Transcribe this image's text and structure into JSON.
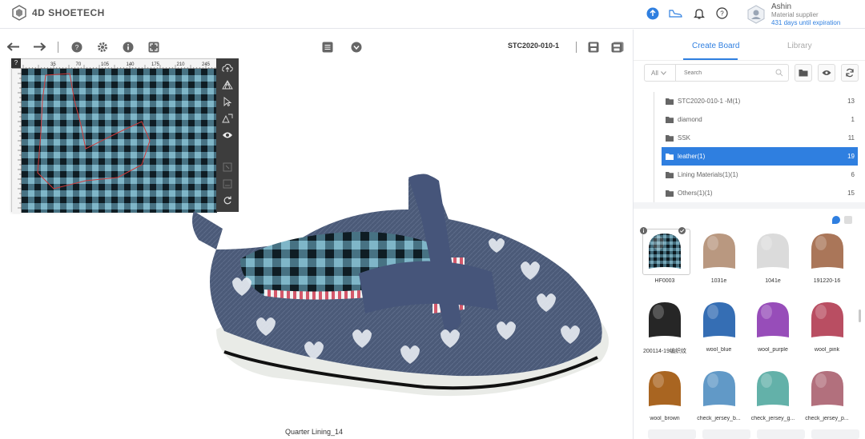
{
  "app": {
    "brand": "4D SHOETECH"
  },
  "user": {
    "name": "Ashin",
    "role": "Material supplier",
    "expiry": "431 days until expiration"
  },
  "toolbar": {
    "model_id": "STC2020-010-1"
  },
  "pattern_panel": {
    "help": "?",
    "ruler_ticks": [
      "35",
      "70",
      "105",
      "140",
      "175",
      "210",
      "245"
    ]
  },
  "viewport": {
    "part_label": "Quarter Lining_14"
  },
  "sidebar": {
    "tabs": [
      {
        "label": "Create Board",
        "active": true
      },
      {
        "label": "Library",
        "active": false
      }
    ],
    "filter": {
      "selected": "All",
      "search_placeholder": "Search"
    },
    "folders": [
      {
        "label": "STC2020-010-1 -M(1)",
        "count": "13",
        "active": false
      },
      {
        "label": "diamond",
        "count": "1",
        "active": false
      },
      {
        "label": "SSK",
        "count": "11",
        "active": false
      },
      {
        "label": "leather(1)",
        "count": "19",
        "active": true
      },
      {
        "label": "Lining Materials(1)(1)",
        "count": "6",
        "active": false
      },
      {
        "label": "Others(1)(1)",
        "count": "15",
        "active": false
      }
    ],
    "materials": [
      {
        "name": "HF0003",
        "color": "#5a9bb0",
        "pattern": "check",
        "selected": true
      },
      {
        "name": "1031e",
        "color": "#c9a58b"
      },
      {
        "name": "1041e",
        "color": "#eeeeee"
      },
      {
        "name": "191220-16",
        "color": "#b98061"
      },
      {
        "name": "200114-19编织纹",
        "color": "#2a2a2a"
      },
      {
        "name": "wool_blue",
        "color": "#3a78c4"
      },
      {
        "name": "wool_purple",
        "color": "#a454c9"
      },
      {
        "name": "wool_pink",
        "color": "#c9556b"
      },
      {
        "name": "wool_brown",
        "color": "#b86e24"
      },
      {
        "name": "check_jersey_b...",
        "color": "#6aa6d8"
      },
      {
        "name": "check_jersey_g...",
        "color": "#6cc0b8"
      },
      {
        "name": "check_jersey_p...",
        "color": "#c27a88"
      }
    ]
  },
  "colors": {
    "accent": "#2f7fe0",
    "panel_dark": "#3d3d3d"
  }
}
